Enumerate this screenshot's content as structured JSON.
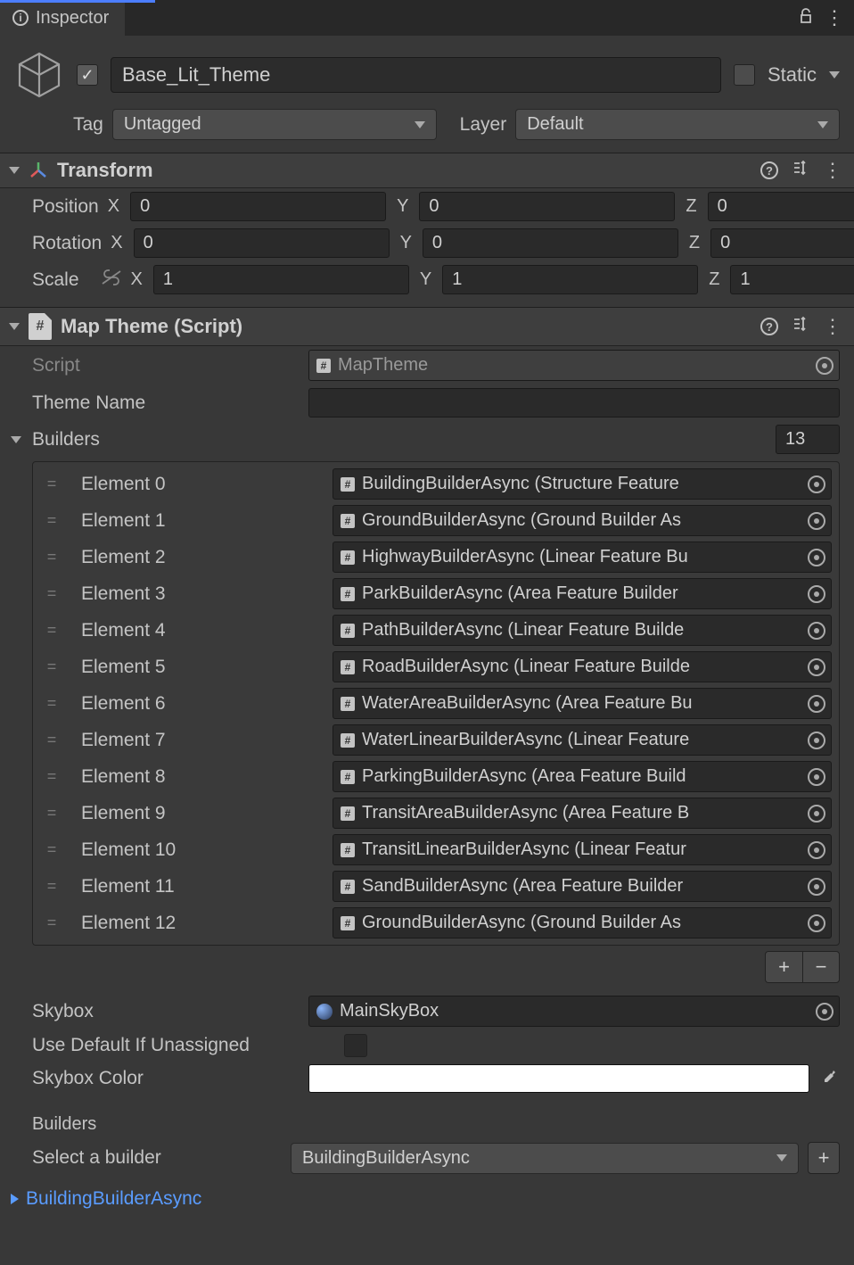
{
  "tab": {
    "title": "Inspector"
  },
  "header": {
    "name": "Base_Lit_Theme",
    "static_label": "Static",
    "tag_label": "Tag",
    "tag_value": "Untagged",
    "layer_label": "Layer",
    "layer_value": "Default"
  },
  "transform": {
    "title": "Transform",
    "position_label": "Position",
    "rotation_label": "Rotation",
    "scale_label": "Scale",
    "x": "X",
    "y": "Y",
    "z": "Z",
    "position": {
      "x": "0",
      "y": "0",
      "z": "0"
    },
    "rotation": {
      "x": "0",
      "y": "0",
      "z": "0"
    },
    "scale": {
      "x": "1",
      "y": "1",
      "z": "1"
    }
  },
  "maptheme": {
    "title": "Map Theme (Script)",
    "script_label": "Script",
    "script_value": "MapTheme",
    "theme_name_label": "Theme Name",
    "theme_name_value": "",
    "builders_label": "Builders",
    "builders_count": "13",
    "elements": [
      {
        "label": "Element 0",
        "value": "BuildingBuilderAsync (Structure Feature"
      },
      {
        "label": "Element 1",
        "value": "GroundBuilderAsync (Ground Builder As"
      },
      {
        "label": "Element 2",
        "value": "HighwayBuilderAsync (Linear Feature Bu"
      },
      {
        "label": "Element 3",
        "value": "ParkBuilderAsync (Area Feature Builder "
      },
      {
        "label": "Element 4",
        "value": "PathBuilderAsync (Linear Feature Builde"
      },
      {
        "label": "Element 5",
        "value": "RoadBuilderAsync (Linear Feature Builde"
      },
      {
        "label": "Element 6",
        "value": "WaterAreaBuilderAsync (Area Feature Bu"
      },
      {
        "label": "Element 7",
        "value": "WaterLinearBuilderAsync (Linear Feature"
      },
      {
        "label": "Element 8",
        "value": "ParkingBuilderAsync (Area Feature Build"
      },
      {
        "label": "Element 9",
        "value": "TransitAreaBuilderAsync (Area Feature B"
      },
      {
        "label": "Element 10",
        "value": "TransitLinearBuilderAsync (Linear Featur"
      },
      {
        "label": "Element 11",
        "value": "SandBuilderAsync (Area Feature Builder"
      },
      {
        "label": "Element 12",
        "value": "GroundBuilderAsync (Ground Builder As"
      }
    ],
    "skybox_label": "Skybox",
    "skybox_value": "MainSkyBox",
    "use_default_label": "Use Default If Unassigned",
    "skybox_color_label": "Skybox Color",
    "skybox_color": "#ffffff"
  },
  "bottom": {
    "builders_heading": "Builders",
    "select_label": "Select a builder",
    "select_value": "BuildingBuilderAsync",
    "expanded_name": "BuildingBuilderAsync"
  },
  "icons": {
    "add": "+",
    "remove": "−",
    "dots": "⋮"
  }
}
